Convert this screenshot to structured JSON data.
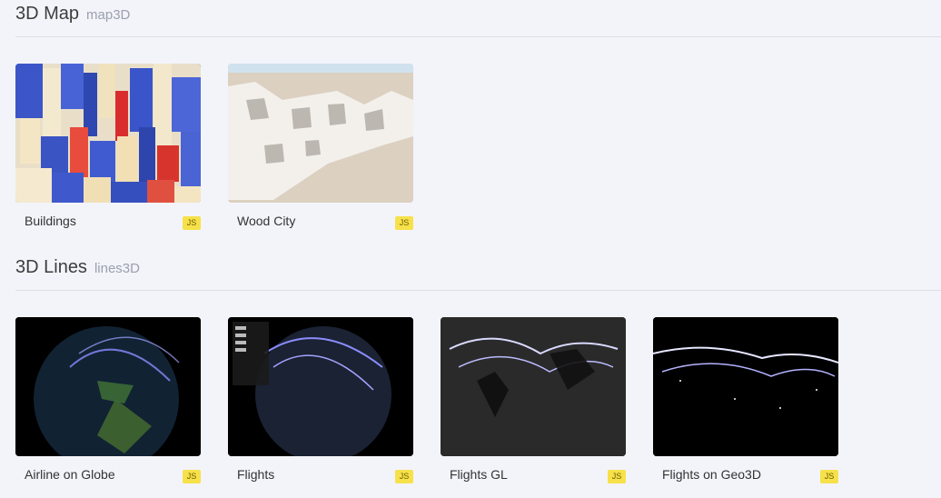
{
  "sections": [
    {
      "title": "3D Map",
      "subtitle": "map3D",
      "items": [
        {
          "title": "Buildings",
          "badge": "JS",
          "thumb_icon": "buildings-thumbnail"
        },
        {
          "title": "Wood City",
          "badge": "JS",
          "thumb_icon": "wood-city-thumbnail"
        }
      ]
    },
    {
      "title": "3D Lines",
      "subtitle": "lines3D",
      "items": [
        {
          "title": "Airline on Globe",
          "badge": "JS",
          "thumb_icon": "airline-globe-thumbnail"
        },
        {
          "title": "Flights",
          "badge": "JS",
          "thumb_icon": "flights-thumbnail"
        },
        {
          "title": "Flights GL",
          "badge": "JS",
          "thumb_icon": "flights-gl-thumbnail"
        },
        {
          "title": "Flights on Geo3D",
          "badge": "JS",
          "thumb_icon": "flights-geo3d-thumbnail"
        }
      ]
    }
  ],
  "colors": {
    "background": "#f3f4fa",
    "badge": "#f7e14a",
    "divider": "#dcdde6"
  }
}
